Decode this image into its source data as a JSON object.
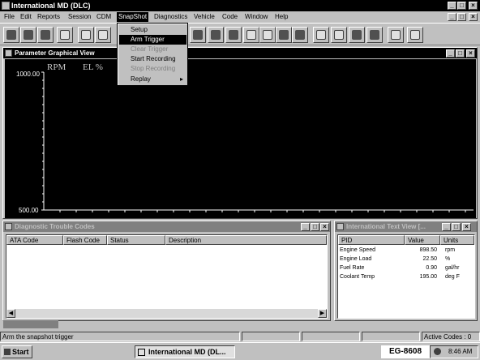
{
  "app": {
    "title": "International MD (DLC)",
    "window_buttons": [
      "_",
      "□",
      "×"
    ]
  },
  "menu": {
    "items": [
      "File",
      "Edit",
      "Reports",
      "Session",
      "CDM",
      "SnapShot",
      "Diagnostics",
      "Vehicle",
      "Code",
      "Window",
      "Help"
    ],
    "active": "SnapShot"
  },
  "snapshot_menu": {
    "items": [
      {
        "label": "Setup",
        "state": "normal"
      },
      {
        "label": "Arm Trigger",
        "state": "highlighted"
      },
      {
        "label": "Clear Trigger",
        "state": "disabled"
      },
      {
        "label": "Start Recording",
        "state": "normal"
      },
      {
        "label": "Stop Recording",
        "state": "disabled"
      },
      {
        "label": "Replay",
        "state": "submenu"
      }
    ]
  },
  "graph_window": {
    "title": "Parameter Graphical View",
    "series_labels": [
      "RPM",
      "EL %"
    ],
    "y_top": "1000.00",
    "y_bottom": "500.00"
  },
  "dtc_window": {
    "title": "Diagnostic Trouble Codes",
    "columns": [
      "ATA Code",
      "Flash Code",
      "Status",
      "Description"
    ]
  },
  "text_view": {
    "title": "International Text View [...",
    "columns": [
      "PID",
      "Value",
      "Units"
    ],
    "rows": [
      {
        "pid": "Engine Speed",
        "value": "898.50",
        "units": "rpm"
      },
      {
        "pid": "Engine Load",
        "value": "22.50",
        "units": "%"
      },
      {
        "pid": "Fuel Rate",
        "value": "0.90",
        "units": "gal/hr"
      },
      {
        "pid": "Coolant Temp",
        "value": "195.00",
        "units": "deg F"
      }
    ]
  },
  "statusbar": {
    "message": "Arm the snapshot trigger",
    "active_codes": "Active Codes : 0"
  },
  "taskbar": {
    "start": "Start",
    "task": "International MD (DL...",
    "label": "EG-8608",
    "clock": "8:46 AM"
  },
  "colors": {
    "window_bg": "#c0c0c0",
    "title_active": "#000000",
    "title_inactive": "#808080",
    "graph_bg": "#000000"
  }
}
